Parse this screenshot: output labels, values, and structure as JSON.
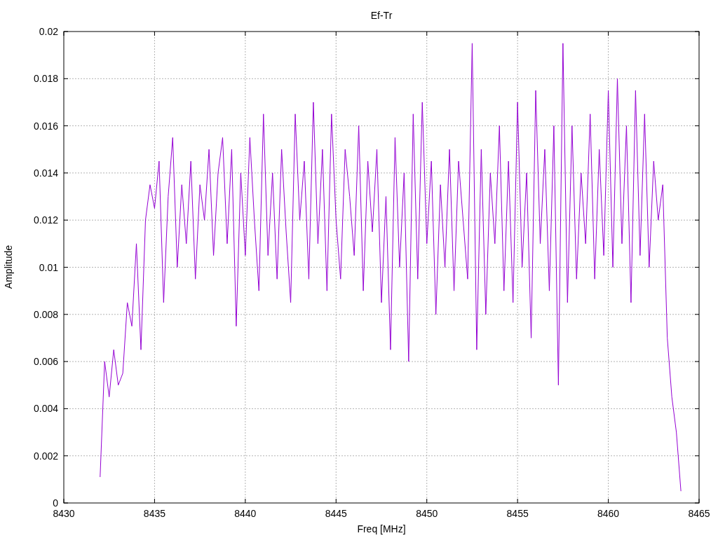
{
  "plot": {
    "chart_data": {
      "type": "line",
      "title": "Ef-Tr",
      "xlabel": "Freq [MHz]",
      "ylabel": "Amplitude",
      "grid": true,
      "xlim": [
        8430,
        8465
      ],
      "ylim": [
        0,
        0.02
      ],
      "xticks": [
        8430,
        8435,
        8440,
        8445,
        8450,
        8455,
        8460,
        8465
      ],
      "yticks": [
        0,
        0.002,
        0.004,
        0.006,
        0.008,
        0.01,
        0.012,
        0.014,
        0.016,
        0.018,
        0.02
      ],
      "x": [
        8432,
        8432.25,
        8432.5,
        8432.75,
        8433,
        8433.25,
        8433.5,
        8433.75,
        8434,
        8434.25,
        8434.5,
        8434.75,
        8435,
        8435.25,
        8435.5,
        8435.75,
        8436,
        8436.25,
        8436.5,
        8436.75,
        8437,
        8437.25,
        8437.5,
        8437.75,
        8438,
        8438.25,
        8438.5,
        8438.75,
        8439,
        8439.25,
        8439.5,
        8439.75,
        8440,
        8440.25,
        8440.5,
        8440.75,
        8441,
        8441.25,
        8441.5,
        8441.75,
        8442,
        8442.25,
        8442.5,
        8442.75,
        8443,
        8443.25,
        8443.5,
        8443.75,
        8444,
        8444.25,
        8444.5,
        8444.75,
        8445,
        8445.25,
        8445.5,
        8445.75,
        8446,
        8446.25,
        8446.5,
        8446.75,
        8447,
        8447.25,
        8447.5,
        8447.75,
        8448,
        8448.25,
        8448.5,
        8448.75,
        8449,
        8449.25,
        8449.5,
        8449.75,
        8450,
        8450.25,
        8450.5,
        8450.75,
        8451,
        8451.25,
        8451.5,
        8451.75,
        8452,
        8452.25,
        8452.5,
        8452.75,
        8453,
        8453.25,
        8453.5,
        8453.75,
        8454,
        8454.25,
        8454.5,
        8454.75,
        8455,
        8455.25,
        8455.5,
        8455.75,
        8456,
        8456.25,
        8456.5,
        8456.75,
        8457,
        8457.25,
        8457.5,
        8457.75,
        8458,
        8458.25,
        8458.5,
        8458.75,
        8459,
        8459.25,
        8459.5,
        8459.75,
        8460,
        8460.25,
        8460.5,
        8460.75,
        8461,
        8461.25,
        8461.5,
        8461.75,
        8462,
        8462.25,
        8462.5,
        8462.75,
        8463,
        8463.25,
        8463.5,
        8463.75,
        8464
      ],
      "series": [
        {
          "color": "#9400d3",
          "values": [
            0.0011,
            0.006,
            0.0045,
            0.0065,
            0.005,
            0.0055,
            0.0085,
            0.0075,
            0.011,
            0.0065,
            0.012,
            0.0135,
            0.0125,
            0.0145,
            0.0085,
            0.013,
            0.0155,
            0.01,
            0.0135,
            0.011,
            0.0145,
            0.0095,
            0.0135,
            0.012,
            0.015,
            0.0105,
            0.014,
            0.0155,
            0.011,
            0.015,
            0.0075,
            0.014,
            0.0105,
            0.0155,
            0.012,
            0.009,
            0.0165,
            0.0105,
            0.014,
            0.0095,
            0.015,
            0.0115,
            0.0085,
            0.0165,
            0.012,
            0.0145,
            0.0095,
            0.017,
            0.011,
            0.015,
            0.009,
            0.0165,
            0.012,
            0.0095,
            0.015,
            0.013,
            0.0105,
            0.016,
            0.009,
            0.0145,
            0.0115,
            0.015,
            0.0085,
            0.013,
            0.0065,
            0.0155,
            0.01,
            0.014,
            0.006,
            0.0165,
            0.0095,
            0.017,
            0.011,
            0.0145,
            0.008,
            0.0135,
            0.01,
            0.015,
            0.009,
            0.0145,
            0.012,
            0.0095,
            0.0195,
            0.0065,
            0.015,
            0.008,
            0.014,
            0.011,
            0.016,
            0.009,
            0.0145,
            0.0085,
            0.017,
            0.01,
            0.014,
            0.007,
            0.0175,
            0.011,
            0.015,
            0.009,
            0.016,
            0.005,
            0.0195,
            0.0085,
            0.016,
            0.0095,
            0.014,
            0.011,
            0.0165,
            0.0095,
            0.015,
            0.0105,
            0.0175,
            0.01,
            0.018,
            0.011,
            0.016,
            0.0085,
            0.0175,
            0.0105,
            0.0165,
            0.01,
            0.0145,
            0.012,
            0.0135,
            0.007,
            0.0045,
            0.003,
            0.0005
          ]
        }
      ]
    }
  }
}
